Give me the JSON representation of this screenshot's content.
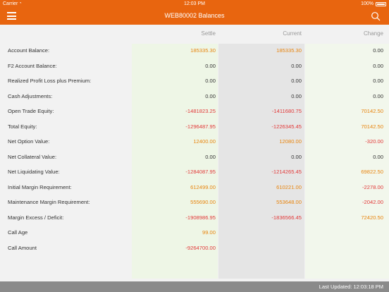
{
  "status": {
    "carrier": "Carrier",
    "time": "12:03 PM",
    "battery": "100%"
  },
  "header": {
    "title": "WEB80002 Balances"
  },
  "columns": {
    "settle": "Settle",
    "current": "Current",
    "change": "Change"
  },
  "rows": [
    {
      "label": "Account Balance:",
      "settle": "185335.30",
      "current": "185335.30",
      "change": "0.00"
    },
    {
      "label": "F2 Account Balance:",
      "settle": "0.00",
      "current": "0.00",
      "change": "0.00"
    },
    {
      "label": "Realized Profit Loss plus Premium:",
      "settle": "0.00",
      "current": "0.00",
      "change": "0.00"
    },
    {
      "label": "Cash Adjustments:",
      "settle": "0.00",
      "current": "0.00",
      "change": "0.00"
    },
    {
      "label": "Open Trade Equity:",
      "settle": "-1481823.25",
      "current": "-1411680.75",
      "change": "70142.50"
    },
    {
      "label": "Total Equity:",
      "settle": "-1296487.95",
      "current": "-1226345.45",
      "change": "70142.50"
    },
    {
      "label": "Net Option Value:",
      "settle": "12400.00",
      "current": "12080.00",
      "change": "-320.00"
    },
    {
      "label": "Net Collateral Value:",
      "settle": "0.00",
      "current": "0.00",
      "change": "0.00"
    },
    {
      "label": "Net Liquidating Value:",
      "settle": "-1284087.95",
      "current": "-1214265.45",
      "change": "69822.50"
    },
    {
      "label": "Initial Margin Requirement:",
      "settle": "612499.00",
      "current": "610221.00",
      "change": "-2278.00"
    },
    {
      "label": "Maintenance Margin Requirement:",
      "settle": "555690.00",
      "current": "553648.00",
      "change": "-2042.00"
    },
    {
      "label": "Margin Excess / Deficit:",
      "settle": "-1908986.95",
      "current": "-1836566.45",
      "change": "72420.50"
    },
    {
      "label": "Call Age",
      "settle": "99.00",
      "current": "",
      "change": ""
    },
    {
      "label": "Call Amount",
      "settle": "-9264700.00",
      "current": "",
      "change": ""
    }
  ],
  "footer": {
    "last_updated": "Last Updated: 12:03:18 PM"
  },
  "colors": {
    "brand": "#e8650f",
    "positive": "#e8850f",
    "negative": "#e23a3a",
    "footer": "#8a8a8a"
  },
  "icons": {
    "menu": "hamburger-icon",
    "search": "search-icon"
  }
}
